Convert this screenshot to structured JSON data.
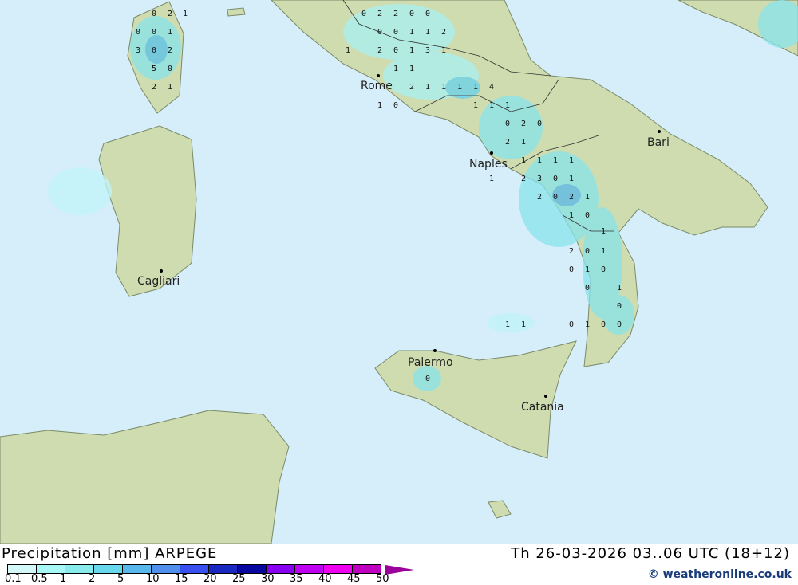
{
  "map": {
    "colors": {
      "sea": "#d6eef9",
      "land": "#cfdcaf",
      "border": "#333333"
    },
    "cities": [
      {
        "name": "Rome"
      },
      {
        "name": "Naples"
      },
      {
        "name": "Bari"
      },
      {
        "name": "Cagliari"
      },
      {
        "name": "Palermo"
      },
      {
        "name": "Catania"
      }
    ],
    "precip_values": [
      "0",
      "2",
      "1",
      "0",
      "0",
      "1",
      "0",
      "2",
      "2",
      "0",
      "0",
      "3",
      "0",
      "2",
      "5",
      "0",
      "2",
      "1",
      "0",
      "0",
      "1",
      "1",
      "2",
      "1",
      "2",
      "0",
      "1",
      "3",
      "1",
      "1",
      "1",
      "2",
      "1",
      "1",
      "1",
      "1",
      "4",
      "1",
      "0",
      "1",
      "1",
      "1",
      "0",
      "2",
      "0",
      "2",
      "1",
      "1",
      "1",
      "1",
      "1",
      "1",
      "2",
      "3",
      "0",
      "1",
      "2",
      "0",
      "2",
      "1",
      "1",
      "0",
      "1",
      "2",
      "0",
      "1",
      "0",
      "1",
      "0",
      "0",
      "1",
      "0",
      "1",
      "1",
      "0",
      "1",
      "0",
      "0",
      "0"
    ]
  },
  "footer": {
    "title": "Precipitation [mm] ARPEGE",
    "datetime": "Th 26-03-2026 03..06 UTC (18+12)",
    "credit": "© weatheronline.co.uk",
    "legend": {
      "colors": [
        "#d4f8f8",
        "#a8f8f8",
        "#88ecec",
        "#68d8ec",
        "#58b8ec",
        "#5090ec",
        "#3850f0",
        "#1828c0",
        "#0808a0",
        "#8800f0",
        "#c000f0",
        "#f000f0",
        "#c000c0"
      ],
      "ticks": [
        "0.1",
        "0.5",
        "1",
        "2",
        "5",
        "10",
        "15",
        "20",
        "25",
        "30",
        "35",
        "40",
        "45",
        "50"
      ]
    }
  }
}
